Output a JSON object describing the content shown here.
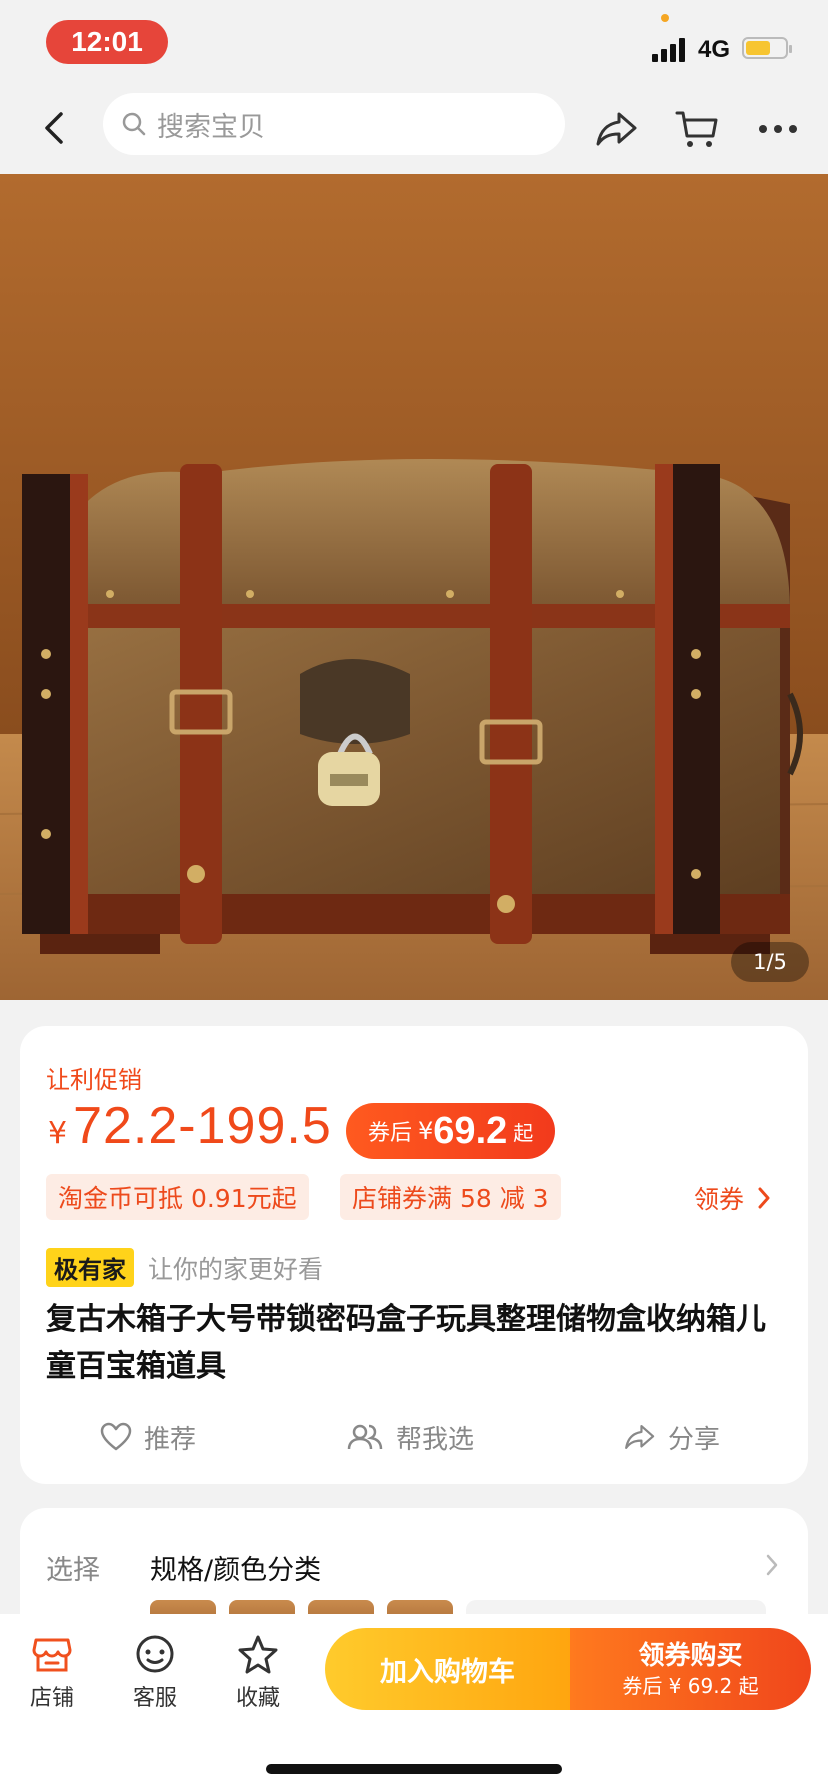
{
  "status_bar": {
    "time": "12:01",
    "network": "4G"
  },
  "nav": {
    "search_placeholder": "搜索宝贝"
  },
  "gallery": {
    "counter": "1/5"
  },
  "product": {
    "promo_label": "让利促销",
    "price_symbol": "¥",
    "price_range": "72.2-199.5",
    "coupon_label": "券后",
    "coupon_symbol": "¥",
    "coupon_price": "69.2",
    "coupon_suffix": "起",
    "chips": [
      "淘金币可抵 0.91元起",
      "店铺券满 58 减 3"
    ],
    "get_coupon": "领券",
    "brand_badge": "极有家",
    "brand_slogan": "让你的家更好看",
    "title": "复古木箱子大号带锁密码盒子玩具整理储物盒收纳箱儿童百宝箱道具",
    "actions": {
      "recommend": "推荐",
      "help_choose": "帮我选",
      "share": "分享"
    }
  },
  "options": {
    "label": "选择",
    "value": "规格/颜色分类"
  },
  "bottom_bar": {
    "tabs": {
      "store": "店铺",
      "service": "客服",
      "favorite": "收藏"
    },
    "add_to_cart": "加入购物车",
    "buy_title": "领券购买",
    "buy_sub": "券后 ¥ 69.2 起"
  },
  "colors": {
    "accent": "#f0491a",
    "cart_button": "#ffb81c",
    "buy_button": "#f0461b",
    "brand_badge": "#ffd31a"
  }
}
